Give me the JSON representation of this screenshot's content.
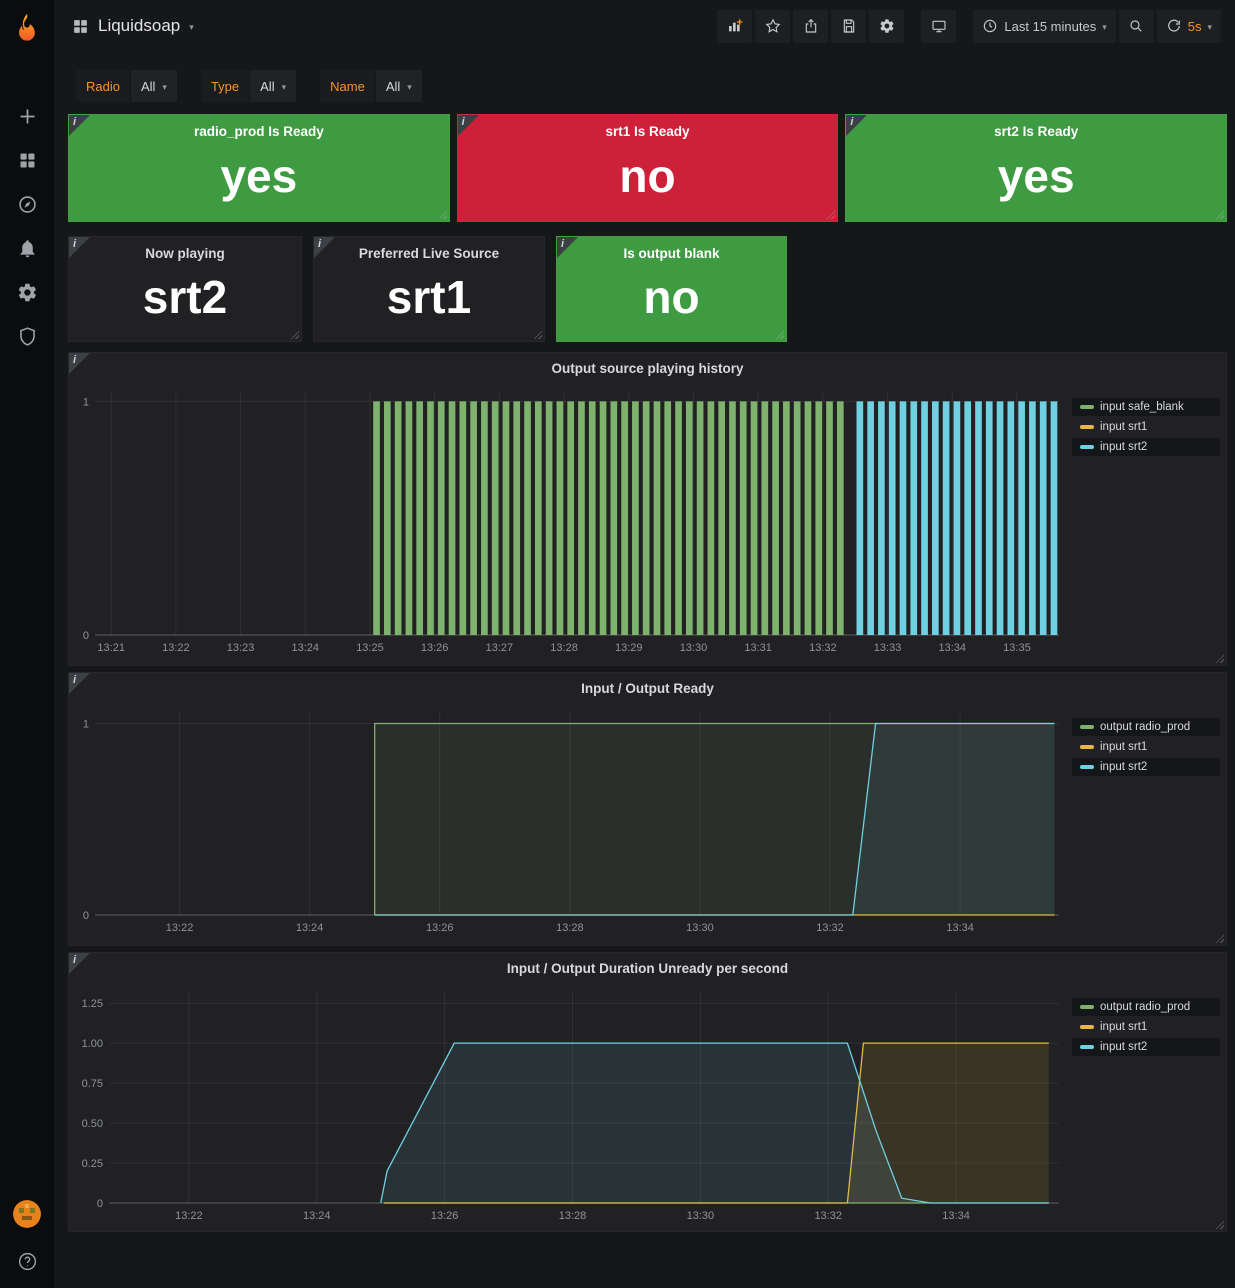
{
  "colors": {
    "page_bg": "#161719",
    "panel_bg": "#212124",
    "green": "#3f9b41",
    "red": "#cd2039",
    "orange": "#f79520",
    "series_green": "#7eb26d",
    "series_yellow": "#eab839",
    "series_blue": "#6ed0e0"
  },
  "icons": {
    "info": "i",
    "caret": "▾",
    "help": "?"
  },
  "header": {
    "title": "Liquidsoap",
    "time_range": "Last 15 minutes",
    "refresh": "5s"
  },
  "filters": [
    {
      "label": "Radio",
      "value": "All"
    },
    {
      "label": "Type",
      "value": "All"
    },
    {
      "label": "Name",
      "value": "All"
    }
  ],
  "stats": [
    {
      "title": "radio_prod Is Ready",
      "value": "yes",
      "bg": "#3f9b41"
    },
    {
      "title": "srt1 Is Ready",
      "value": "no",
      "bg": "#cd2039"
    },
    {
      "title": "srt2 Is Ready",
      "value": "yes",
      "bg": "#3f9b41"
    },
    {
      "title": "Now playing",
      "value": "srt2",
      "bg": "#212124"
    },
    {
      "title": "Preferred Live Source",
      "value": "srt1",
      "bg": "#212124"
    },
    {
      "title": "Is output blank",
      "value": "no",
      "bg": "#3f9b41"
    }
  ],
  "chart_data": [
    {
      "type": "bar",
      "title": "Output source playing history",
      "x_domain": [
        0.75,
        15.65
      ],
      "x_ticks": [
        {
          "v": 1,
          "label": "13:21"
        },
        {
          "v": 2,
          "label": "13:22"
        },
        {
          "v": 3,
          "label": "13:23"
        },
        {
          "v": 4,
          "label": "13:24"
        },
        {
          "v": 5,
          "label": "13:25"
        },
        {
          "v": 6,
          "label": "13:26"
        },
        {
          "v": 7,
          "label": "13:27"
        },
        {
          "v": 8,
          "label": "13:28"
        },
        {
          "v": 9,
          "label": "13:29"
        },
        {
          "v": 10,
          "label": "13:30"
        },
        {
          "v": 11,
          "label": "13:31"
        },
        {
          "v": 12,
          "label": "13:32"
        },
        {
          "v": 13,
          "label": "13:33"
        },
        {
          "v": 14,
          "label": "13:34"
        },
        {
          "v": 15,
          "label": "13:35"
        }
      ],
      "ylim": [
        0,
        1.04
      ],
      "y_ticks": [
        {
          "v": 0,
          "label": "0"
        },
        {
          "v": 1,
          "label": "1"
        }
      ],
      "bar_interval": 0.1667,
      "bar_width": 0.62,
      "segments": [
        {
          "series": "input safe_blank",
          "value": 1,
          "start": 5.05,
          "end": 12.38
        },
        {
          "series": "input srt2",
          "value": 1,
          "start": 12.52,
          "end": 15.62
        }
      ],
      "legend": [
        {
          "label": "input safe_blank",
          "color": "#7eb26d",
          "highlight": true
        },
        {
          "label": "input srt1",
          "color": "#eab839",
          "highlight": false
        },
        {
          "label": "input srt2",
          "color": "#6ed0e0",
          "highlight": true
        }
      ]
    },
    {
      "type": "line",
      "title": "Input / Output Ready",
      "x_domain": [
        0.7,
        15.52
      ],
      "x_ticks": [
        {
          "v": 2,
          "label": "13:22"
        },
        {
          "v": 4,
          "label": "13:24"
        },
        {
          "v": 6,
          "label": "13:26"
        },
        {
          "v": 8,
          "label": "13:28"
        },
        {
          "v": 10,
          "label": "13:30"
        },
        {
          "v": 12,
          "label": "13:32"
        },
        {
          "v": 14,
          "label": "13:34"
        }
      ],
      "ylim": [
        0,
        1.06
      ],
      "y_ticks": [
        {
          "v": 0,
          "label": "0"
        },
        {
          "v": 1,
          "label": "1"
        }
      ],
      "series": [
        {
          "name": "output radio_prod",
          "color": "#7eb26d",
          "fill": 0.1,
          "points": [
            [
              5.0,
              0
            ],
            [
              5.0,
              1
            ],
            [
              15.45,
              1
            ]
          ]
        },
        {
          "name": "input srt1",
          "color": "#eab839",
          "fill": 0,
          "points": [
            [
              5.0,
              0
            ],
            [
              15.45,
              0
            ]
          ]
        },
        {
          "name": "input srt2",
          "color": "#6ed0e0",
          "fill": 0.08,
          "points": [
            [
              5.0,
              0
            ],
            [
              12.35,
              0
            ],
            [
              12.7,
              1
            ],
            [
              15.45,
              1
            ]
          ]
        }
      ],
      "legend": [
        {
          "label": "output radio_prod",
          "color": "#7eb26d",
          "highlight": true
        },
        {
          "label": "input srt1",
          "color": "#eab839",
          "highlight": false
        },
        {
          "label": "input srt2",
          "color": "#6ed0e0",
          "highlight": true
        }
      ]
    },
    {
      "type": "line",
      "title": "Input / Output Duration Unready per second",
      "x_domain": [
        0.75,
        15.61
      ],
      "x_ticks": [
        {
          "v": 2,
          "label": "13:22"
        },
        {
          "v": 4,
          "label": "13:24"
        },
        {
          "v": 6,
          "label": "13:26"
        },
        {
          "v": 8,
          "label": "13:28"
        },
        {
          "v": 10,
          "label": "13:30"
        },
        {
          "v": 12,
          "label": "13:32"
        },
        {
          "v": 14,
          "label": "13:34"
        }
      ],
      "ylim": [
        0,
        1.32
      ],
      "y_ticks": [
        {
          "v": 0,
          "label": "0"
        },
        {
          "v": 0.25,
          "label": "0.25"
        },
        {
          "v": 0.5,
          "label": "0.50"
        },
        {
          "v": 0.75,
          "label": "0.75"
        },
        {
          "v": 1,
          "label": "1.00"
        },
        {
          "v": 1.25,
          "label": "1.25"
        }
      ],
      "series": [
        {
          "name": "output radio_prod",
          "color": "#7eb26d",
          "fill": 0,
          "points": [
            [
              5.05,
              0
            ],
            [
              15.45,
              0
            ]
          ]
        },
        {
          "name": "input srt1",
          "color": "#eab839",
          "fill": 0.13,
          "points": [
            [
              5.05,
              0
            ],
            [
              12.3,
              0
            ],
            [
              12.55,
              1
            ],
            [
              15.45,
              1
            ]
          ]
        },
        {
          "name": "input srt2",
          "color": "#6ed0e0",
          "fill": 0.1,
          "points": [
            [
              5.0,
              0
            ],
            [
              5.1,
              0.2
            ],
            [
              6.15,
              1
            ],
            [
              12.3,
              1
            ],
            [
              12.75,
              0.45
            ],
            [
              13.15,
              0.03
            ],
            [
              13.6,
              0
            ],
            [
              15.45,
              0
            ]
          ]
        }
      ],
      "legend": [
        {
          "label": "output radio_prod",
          "color": "#7eb26d",
          "highlight": true
        },
        {
          "label": "input srt1",
          "color": "#eab839",
          "highlight": false
        },
        {
          "label": "input srt2",
          "color": "#6ed0e0",
          "highlight": true
        }
      ]
    }
  ]
}
